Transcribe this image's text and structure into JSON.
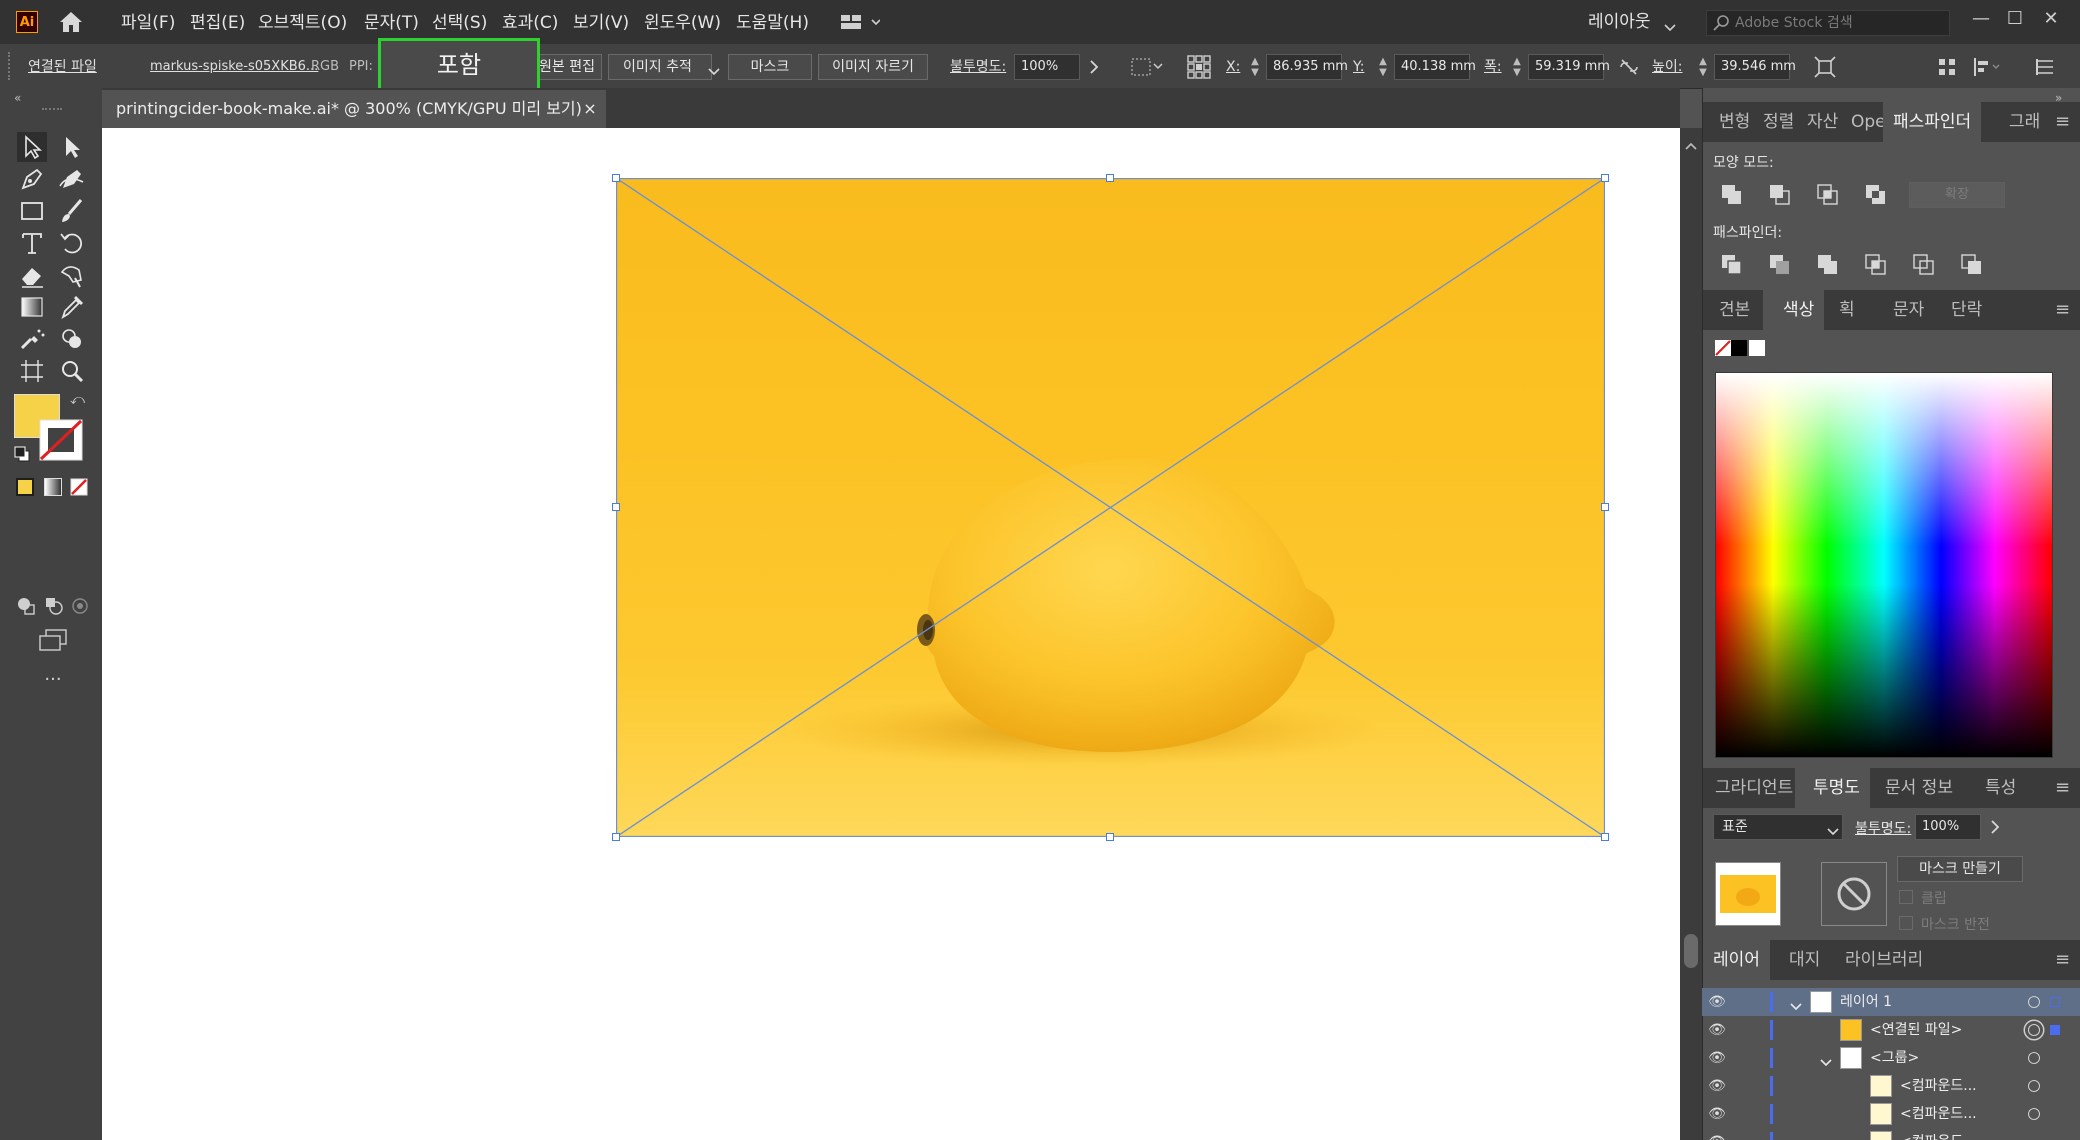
{
  "app": {
    "logo": "Ai"
  },
  "menu": [
    "파일(F)",
    "편집(E)",
    "오브젝트(O)",
    "문자(T)",
    "선택(S)",
    "효과(C)",
    "보기(V)",
    "윈도우(W)",
    "도움말(H)"
  ],
  "workspace": {
    "label": "레이아웃"
  },
  "search": {
    "placeholder": "Adobe Stock 검색"
  },
  "window_controls": {
    "minimize": "—",
    "maximize": "☐",
    "close": "✕"
  },
  "control_bar": {
    "linked_file": "연결된 파일",
    "file_name": "markus-spiske-s05XKB6...",
    "color_mode": "RGB",
    "ppi_label": "PPI:",
    "embed_tooltip": "포함",
    "edit_original": "원본 편집",
    "image_trace": "이미지 추적",
    "mask": "마스크",
    "crop_image": "이미지 자르기",
    "opacity_label": "불투명도:",
    "opacity_value": "100%",
    "x_label": "X:",
    "x_value": "86.935 mm",
    "y_label": "Y:",
    "y_value": "40.138 mm",
    "w_label": "폭:",
    "w_value": "59.319 mm",
    "h_label": "높이:",
    "h_value": "39.546 mm"
  },
  "document_tab": {
    "title": "printingcider-book-make.ai*  @  300%  (CMYK/GPU 미리 보기)",
    "close": "×"
  },
  "tools": {
    "more": "..."
  },
  "panels": {
    "pathfinder": {
      "tabs": [
        "변형",
        "정렬",
        "자산",
        "Ope",
        "패스파인더",
        "그래"
      ],
      "shape_modes_label": "모양 모드:",
      "expand_label": "확장",
      "pathfinders_label": "패스파인더:"
    },
    "color": {
      "tabs": [
        "견본",
        "색상",
        "획",
        "문자",
        "단락"
      ],
      "fill_color": "#f6d248"
    },
    "transparency": {
      "tabs": [
        "그라디언트",
        "투명도",
        "문서 정보",
        "특성"
      ],
      "blend_mode": "표준",
      "opacity_label": "불투명도:",
      "opacity_value": "100%",
      "make_mask": "마스크 만들기",
      "clip": "클립",
      "invert_mask": "마스크 반전"
    },
    "layers": {
      "tabs": [
        "레이어",
        "대지",
        "라이브러리"
      ],
      "rows": [
        {
          "name": "레이어 1"
        },
        {
          "name": "<연결된 파일>"
        },
        {
          "name": "<그룹>"
        },
        {
          "name": "<컴파운드..."
        },
        {
          "name": "<컴파운드..."
        },
        {
          "name": "<컴파운드..."
        }
      ]
    }
  }
}
